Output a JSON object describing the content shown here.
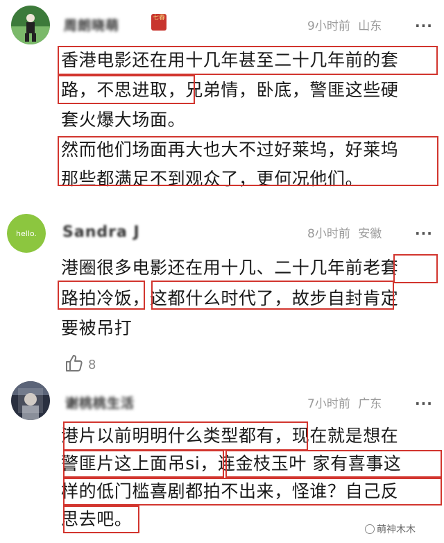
{
  "comments": [
    {
      "username": "周朗晓萌",
      "badge": "七春",
      "time": "9小时前",
      "location": "山东",
      "lines": [
        "香港电影还在用十几年甚至二十几年前的套",
        "路，不思进取，兄弟情，卧底，警匪这些硬",
        "套火爆大场面。",
        "然而他们场面再大也大不过好莱坞，好莱坞",
        "那些都满足不到观众了，更何况他们。"
      ]
    },
    {
      "username": "Sandra J",
      "avatar_text": "hello.",
      "time": "8小时前",
      "location": "安徽",
      "lines": [
        "港圈很多电影还在用十几、二十几年前老套",
        "路拍冷饭，这都什么时代了，故步自封肯定",
        "要被吊打"
      ],
      "likes": "8"
    },
    {
      "username": "谢桃桃生活",
      "time": "7小时前",
      "location": "广东",
      "lines": [
        "港片以前明明什么类型都有，现在就是想在",
        "警匪片这上面吊si，连金枝玉叶 家有喜事这",
        "样的低门槛喜剧都拍不出来，怪谁？自己反",
        "思去吧。"
      ]
    }
  ],
  "more_label": "···",
  "watermark": "萌神木木",
  "colors": {
    "highlight": "#d2352e",
    "avatar2": "#8cc63f"
  },
  "icons": [
    "more-dots-icon",
    "thumbs-up-icon",
    "watermark-logo-icon"
  ]
}
